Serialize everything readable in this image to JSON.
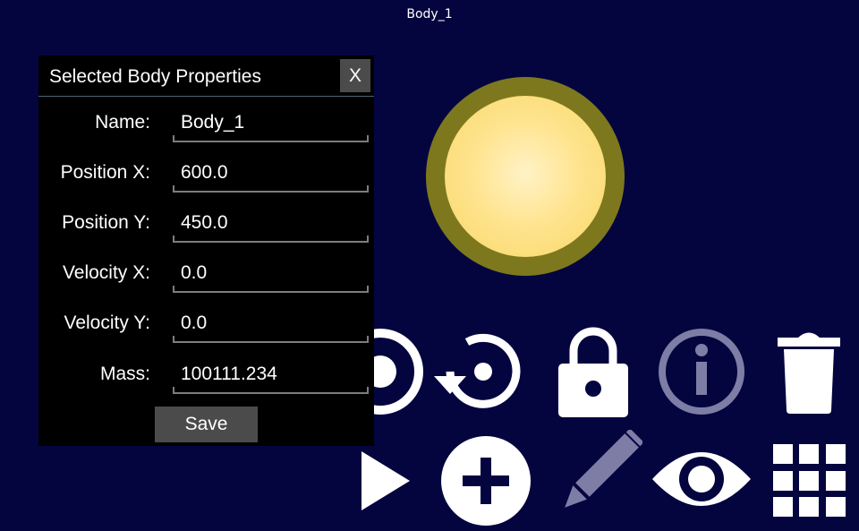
{
  "topbar": {
    "title": "Body_1"
  },
  "dialog": {
    "title": "Selected Body Properties",
    "close_label": "X",
    "fields": [
      {
        "label": "Name:",
        "value": "Body_1"
      },
      {
        "label": "Position X:",
        "value": "600.0"
      },
      {
        "label": "Position Y:",
        "value": "450.0"
      },
      {
        "label": "Velocity X:",
        "value": "0.0"
      },
      {
        "label": "Velocity Y:",
        "value": "0.0"
      },
      {
        "label": "Mass:",
        "value": "100111.234"
      }
    ],
    "save_label": "Save"
  },
  "toolbar": {
    "row1": [
      "target-icon",
      "reset-icon",
      "lock-icon",
      "info-icon",
      "trash-icon"
    ],
    "row2": [
      "play-icon",
      "add-icon",
      "pencil-icon",
      "eye-icon",
      "grid-icon"
    ]
  },
  "colors": {
    "background": "#04053f",
    "icon_active": "#ffffff",
    "icon_disabled": "#7d7da6",
    "body_ring": "#7d781d",
    "body_core": "#ffe490"
  }
}
